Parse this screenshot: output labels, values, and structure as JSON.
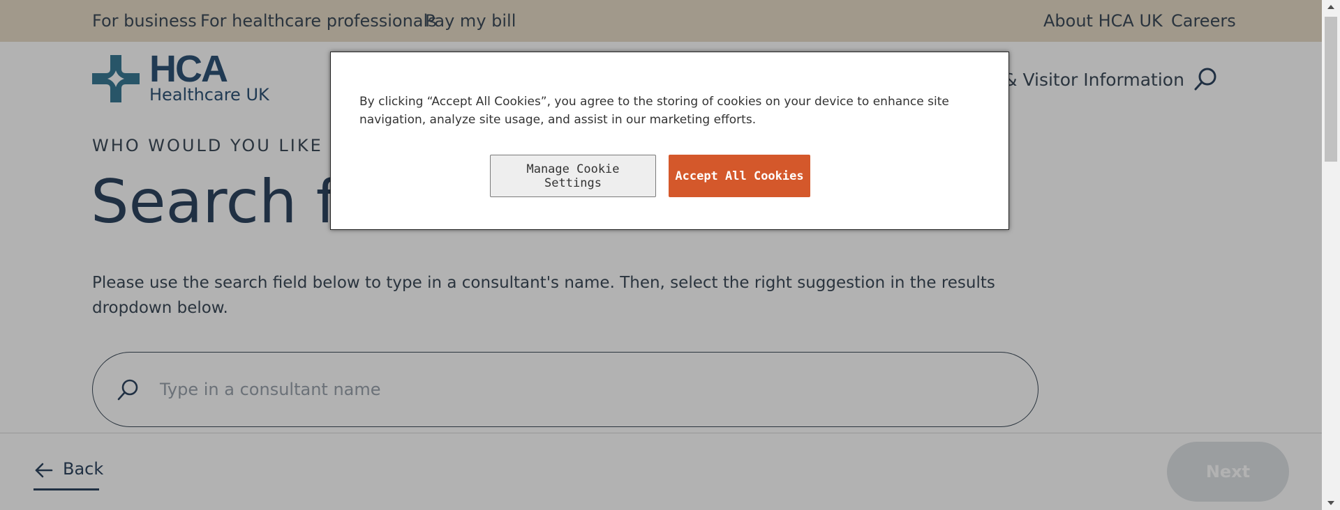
{
  "topbar": {
    "left_links": [
      "For business",
      "For healthcare professionals",
      "Pay my bill"
    ],
    "right_links": [
      "About HCA UK",
      "Careers"
    ]
  },
  "header": {
    "logo_main": "HCA",
    "logo_sub": "Healthcare UK",
    "nav_partial": "& Visitor Information",
    "search_icon": "search-icon"
  },
  "main": {
    "eyebrow": "WHO WOULD YOU LIKE T",
    "hero_partial": "Search fo",
    "intro": "Please use the search field below to type in a consultant's name.  Then, select the right suggestion in the results dropdown below.",
    "search": {
      "placeholder": "Type in a consultant name",
      "value": ""
    }
  },
  "footer": {
    "back_label": "Back",
    "next_label": "Next"
  },
  "cookie_modal": {
    "text": "By clicking “Accept All Cookies”, you agree to the storing of cookies on your device to enhance site navigation, analyze site usage, and assist in our marketing efforts.",
    "manage_label": "Manage Cookie Settings",
    "accept_label": "Accept All Cookies"
  },
  "colors": {
    "topbar_bg": "#e7dcc8",
    "brand_blue": "#2f5377",
    "logo_teal": "#3a7a96",
    "text_dark": "#3d4b5a",
    "accept_orange": "#d4582b",
    "overlay": "rgba(0,0,0,0.30)"
  }
}
